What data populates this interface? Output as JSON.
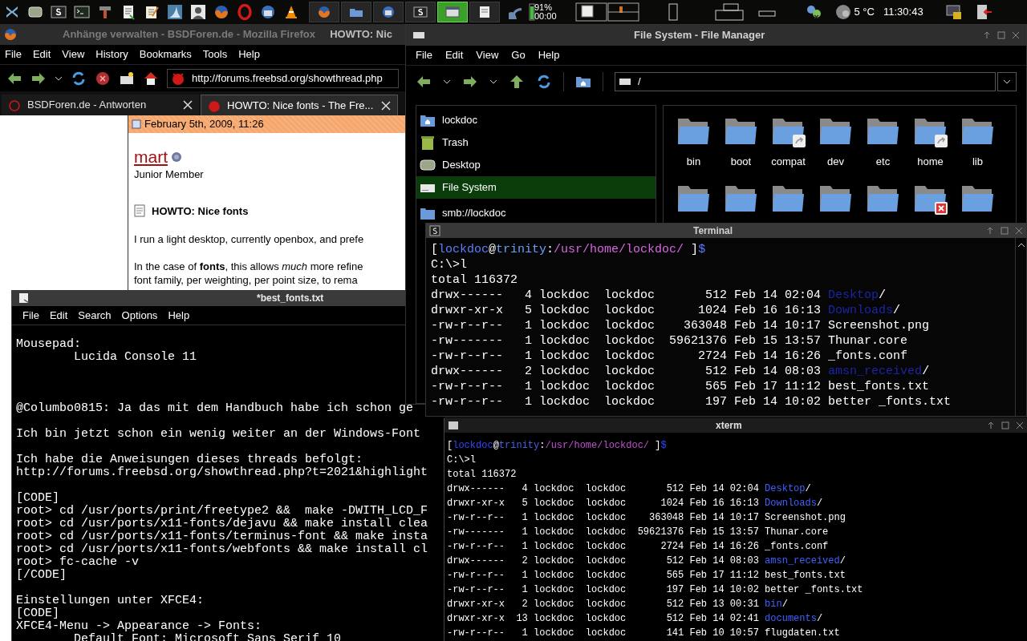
{
  "panel": {
    "taskbar": [
      {
        "selected": false
      },
      {
        "selected": false
      },
      {
        "selected": false
      },
      {
        "selected": false
      },
      {
        "selected": true
      },
      {
        "selected": false
      }
    ],
    "battery": {
      "percent": "91%",
      "time": "00:00"
    },
    "weather": {
      "temperature": "5 °C"
    },
    "clock": "11:30:43"
  },
  "firefox": {
    "title": "Anhänge verwalten - BSDForen.de - Mozilla Firefox",
    "title_overlay": "HOWTO: Nic",
    "menu": [
      "File",
      "Edit",
      "View",
      "History",
      "Bookmarks",
      "Tools",
      "Help"
    ],
    "url": "http://forums.freebsd.org/showthread.php",
    "tabs": [
      {
        "label": "BSDForen.de - Antworten",
        "selected": false
      },
      {
        "label": "HOWTO: Nice fonts - The Fre...",
        "selected": true
      }
    ],
    "post": {
      "date": "February 5th, 2009, 11:26",
      "author": "mart",
      "rank": "Junior Member",
      "title": "HOWTO: Nice fonts",
      "paragraphs": [
        [
          "I run a light desktop, currently openbox, and prefe"
        ],
        [
          "In the case of **fonts**, this allows *much* more refine",
          "font family, per weighting, per point size, to rema"
        ]
      ]
    }
  },
  "file_manager": {
    "title": "File System - File Manager",
    "menu": [
      "File",
      "Edit",
      "View",
      "Go",
      "Help"
    ],
    "path": "/",
    "places": [
      {
        "label": "lockdoc",
        "kind": "home",
        "selected": false
      },
      {
        "label": "Trash",
        "kind": "trash",
        "selected": false
      },
      {
        "label": "Desktop",
        "kind": "desktop",
        "selected": false
      },
      {
        "label": "File System",
        "kind": "drive",
        "selected": true
      },
      {
        "label": "smb://lockdoc",
        "kind": "folder",
        "selected": false
      }
    ],
    "folders": [
      {
        "name": "bin",
        "kind": "folder"
      },
      {
        "name": "boot",
        "kind": "folder"
      },
      {
        "name": "compat",
        "kind": "link"
      },
      {
        "name": "dev",
        "kind": "folder"
      },
      {
        "name": "etc",
        "kind": "folder"
      },
      {
        "name": "home",
        "kind": "link"
      },
      {
        "name": "lib",
        "kind": "folder"
      }
    ],
    "folders_row_2": [
      {
        "kind": "folder"
      },
      {
        "kind": "folder"
      },
      {
        "kind": "folder"
      },
      {
        "kind": "folder"
      },
      {
        "kind": "folder"
      },
      {
        "kind": "denied"
      },
      {
        "kind": "folder"
      }
    ]
  },
  "mousepad": {
    "title": "*best_fonts.txt",
    "menu": [
      "File",
      "Edit",
      "Search",
      "Options",
      "Help"
    ],
    "lines": [
      {
        "kind": "line",
        "text": "Mousepad:"
      },
      {
        "kind": "line",
        "text": "        Lucida Console 11"
      },
      {
        "kind": "blank"
      },
      {
        "kind": "blank"
      },
      {
        "kind": "blank"
      },
      {
        "kind": "line",
        "text": "@Columbo0815: Ja das mit dem Handbuch habe ich schon ge"
      },
      {
        "kind": "blank"
      },
      {
        "kind": "line",
        "text": "Ich bin jetzt schon ein wenig weiter an der Windows-Font"
      },
      {
        "kind": "blank"
      },
      {
        "kind": "line",
        "text": "Ich habe die Anweisungen dieses threads befolgt:"
      },
      {
        "kind": "line",
        "text": "http://forums.freebsd.org/showthread.php?t=2021&highlight"
      },
      {
        "kind": "blank"
      },
      {
        "kind": "line",
        "text": "[CODE]"
      },
      {
        "kind": "line",
        "text": "root> cd /usr/ports/print/freetype2 &&  make -DWITH_LCD_F"
      },
      {
        "kind": "line",
        "text": "root> cd /usr/ports/x11-fonts/dejavu && make install clea"
      },
      {
        "kind": "line",
        "text": "root> cd /usr/ports/x11-fonts/terminus-font && make insta"
      },
      {
        "kind": "line",
        "text": "root> cd /usr/ports/x11-fonts/webfonts && make install cl"
      },
      {
        "kind": "line",
        "text": "root> fc-cache -v"
      },
      {
        "kind": "line",
        "text": "[/CODE]"
      },
      {
        "kind": "blank"
      },
      {
        "kind": "line",
        "text": "Einstellungen unter XFCE4:"
      },
      {
        "kind": "line",
        "text": "[CODE]"
      },
      {
        "kind": "line",
        "text": "XFCE4-Menu -> Appearance -> Fonts:"
      },
      {
        "kind": "line",
        "text": "        Default Font: Microsoft Sans Serif 10"
      }
    ]
  },
  "terminal": {
    "title": "Terminal",
    "prompt": [
      {
        "text": "[",
        "kind": "plain"
      },
      {
        "text": "lockdoc",
        "kind": "user"
      },
      {
        "text": "@",
        "kind": "plain"
      },
      {
        "text": "trinity",
        "kind": "host"
      },
      {
        "text": ":",
        "kind": "plain"
      },
      {
        "text": "/usr/home/lockdoc/",
        "kind": "path"
      },
      {
        "text": " ]",
        "kind": "plain"
      },
      {
        "text": "$",
        "kind": "user"
      }
    ],
    "lines": [
      "C:\\>l",
      "total 116372"
    ],
    "entries": [
      {
        "info": "drwx------   4 lockdoc  lockdoc       512 Feb 14 02:04",
        "name": "Desktop",
        "kind": "dir",
        "suffix": "/"
      },
      {
        "info": "drwxr-xr-x   5 lockdoc  lockdoc      1024 Feb 16 16:13",
        "name": "Downloads",
        "kind": "dir",
        "suffix": "/"
      },
      {
        "info": "-rw-r--r--   1 lockdoc  lockdoc    363048 Feb 14 10:17",
        "name": "Screenshot.png",
        "kind": "file"
      },
      {
        "info": "-rw-------   1 lockdoc  lockdoc  59621376 Feb 15 13:57",
        "name": "Thunar.core",
        "kind": "file"
      },
      {
        "info": "-rw-r--r--   1 lockdoc  lockdoc      2724 Feb 14 16:26",
        "name": "_fonts.conf",
        "kind": "file"
      },
      {
        "info": "drwx------   2 lockdoc  lockdoc       512 Feb 14 08:03",
        "name": "amsn_received",
        "kind": "dir",
        "suffix": "/"
      },
      {
        "info": "-rw-r--r--   1 lockdoc  lockdoc       565 Feb 17 11:12",
        "name": "best_fonts.txt",
        "kind": "file"
      },
      {
        "info": "-rw-r--r--   1 lockdoc  lockdoc       197 Feb 14 10:02",
        "name": "better _fonts.txt",
        "kind": "file"
      }
    ]
  },
  "xterm": {
    "title": "xterm",
    "prompt": [
      {
        "text": "[",
        "kind": "plain"
      },
      {
        "text": "lockdoc",
        "kind": "user"
      },
      {
        "text": "@",
        "kind": "plain"
      },
      {
        "text": "trinity",
        "kind": "host"
      },
      {
        "text": ":",
        "kind": "plain"
      },
      {
        "text": "/usr/home/lockdoc/",
        "kind": "path"
      },
      {
        "text": " ]",
        "kind": "plain"
      },
      {
        "text": "$",
        "kind": "user"
      }
    ],
    "lines": [
      "C:\\>l",
      "total 116372"
    ],
    "entries": [
      {
        "info": "drwx------   4 lockdoc  lockdoc       512 Feb 14 02:04",
        "name": "Desktop",
        "kind": "dir",
        "suffix": "/"
      },
      {
        "info": "drwxr-xr-x   5 lockdoc  lockdoc      1024 Feb 16 16:13",
        "name": "Downloads",
        "kind": "dir",
        "suffix": "/"
      },
      {
        "info": "-rw-r--r--   1 lockdoc  lockdoc    363048 Feb 14 10:17",
        "name": "Screenshot.png",
        "kind": "file"
      },
      {
        "info": "-rw-------   1 lockdoc  lockdoc  59621376 Feb 15 13:57",
        "name": "Thunar.core",
        "kind": "file"
      },
      {
        "info": "-rw-r--r--   1 lockdoc  lockdoc      2724 Feb 14 16:26",
        "name": "_fonts.conf",
        "kind": "file"
      },
      {
        "info": "drwx------   2 lockdoc  lockdoc       512 Feb 14 08:03",
        "name": "amsn_received",
        "kind": "dir",
        "suffix": "/"
      },
      {
        "info": "-rw-r--r--   1 lockdoc  lockdoc       565 Feb 17 11:12",
        "name": "best_fonts.txt",
        "kind": "file"
      },
      {
        "info": "-rw-r--r--   1 lockdoc  lockdoc       197 Feb 14 10:02",
        "name": "better _fonts.txt",
        "kind": "file"
      },
      {
        "info": "drwxr-xr-x   2 lockdoc  lockdoc       512 Feb 13 00:31",
        "name": "bin",
        "kind": "dir",
        "suffix": "/"
      },
      {
        "info": "drwxr-xr-x  13 lockdoc  lockdoc       512 Feb 14 02:41",
        "name": "documents",
        "kind": "dir",
        "suffix": "/"
      },
      {
        "info": "-rw-r--r--   1 lockdoc  lockdoc       141 Feb 10 10:57",
        "name": "flugdaten.txt",
        "kind": "file"
      }
    ]
  }
}
